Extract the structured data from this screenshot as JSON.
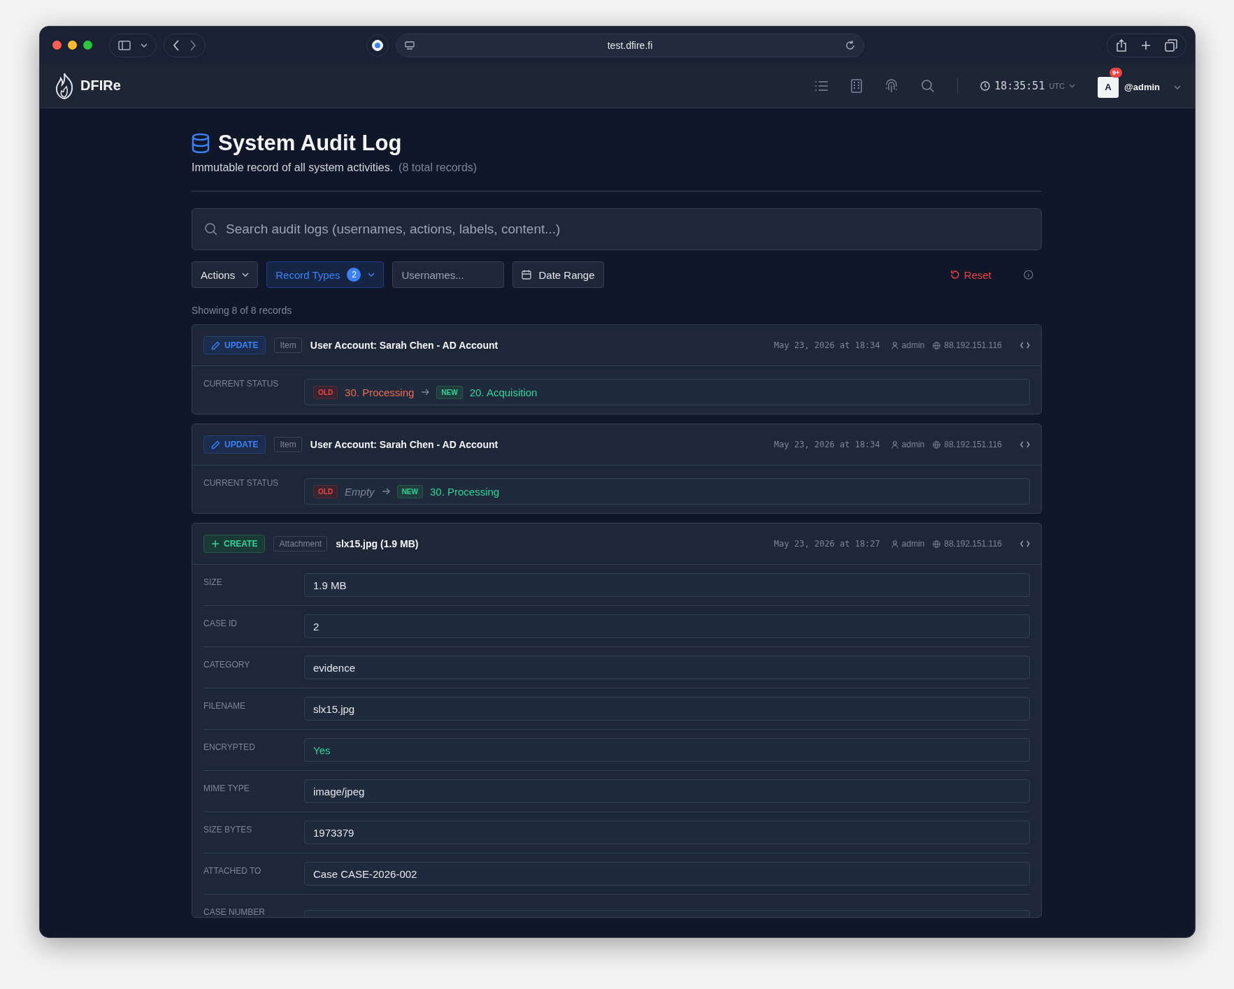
{
  "browser": {
    "url": "test.dfire.fi"
  },
  "navbar": {
    "brand": "DFIRe",
    "clock": "18:35:51",
    "timezone": "UTC",
    "notifications": "9+",
    "avatar": "A",
    "user": "@admin"
  },
  "header": {
    "title": "System Audit Log",
    "subtitle": "Immutable record of all system activities.",
    "total": "(8 total records)"
  },
  "search": {
    "placeholder": "Search audit logs (usernames, actions, labels, content...)"
  },
  "filters": {
    "actions": "Actions",
    "record_types": {
      "label": "Record Types",
      "count": "2"
    },
    "usernames": {
      "placeholder": "Usernames..."
    },
    "date_range": "Date Range",
    "reset": "Reset"
  },
  "showing": "Showing 8 of 8 records",
  "records": [
    {
      "kind": "update",
      "action_label": "UPDATE",
      "type": "Item",
      "title": "User Account: Sarah Chen - AD Account",
      "timestamp": "May 23, 2026 at 18:34",
      "user": "admin",
      "ip": "88.192.151.116",
      "fields": [
        {
          "kind": "change",
          "label": "CURRENT STATUS",
          "old_tag": "OLD",
          "old": "30. Processing",
          "old_empty": false,
          "new_tag": "NEW",
          "new": "20. Acquisition"
        }
      ]
    },
    {
      "kind": "update",
      "action_label": "UPDATE",
      "type": "Item",
      "title": "User Account: Sarah Chen - AD Account",
      "timestamp": "May 23, 2026 at 18:34",
      "user": "admin",
      "ip": "88.192.151.116",
      "fields": [
        {
          "kind": "change",
          "label": "CURRENT STATUS",
          "old_tag": "OLD",
          "old": "Empty",
          "old_empty": true,
          "new_tag": "NEW",
          "new": "30. Processing"
        }
      ]
    },
    {
      "kind": "create",
      "action_label": "CREATE",
      "type": "Attachment",
      "title": "slx15.jpg (1.9 MB)",
      "timestamp": "May 23, 2026 at 18:27",
      "user": "admin",
      "ip": "88.192.151.116",
      "fields": [
        {
          "kind": "text",
          "label": "SIZE",
          "value": "1.9 MB"
        },
        {
          "kind": "text",
          "label": "CASE ID",
          "value": "2"
        },
        {
          "kind": "text",
          "label": "CATEGORY",
          "value": "evidence"
        },
        {
          "kind": "text",
          "label": "FILENAME",
          "value": "slx15.jpg"
        },
        {
          "kind": "yes",
          "label": "ENCRYPTED",
          "value": "Yes"
        },
        {
          "kind": "text",
          "label": "MIME TYPE",
          "value": "image/jpeg"
        },
        {
          "kind": "text",
          "label": "SIZE BYTES",
          "value": "1973379"
        },
        {
          "kind": "text",
          "label": "ATTACHED TO",
          "value": "Case CASE-2026-002"
        },
        {
          "kind": "cut",
          "label": "CASE NUMBER"
        }
      ]
    }
  ]
}
